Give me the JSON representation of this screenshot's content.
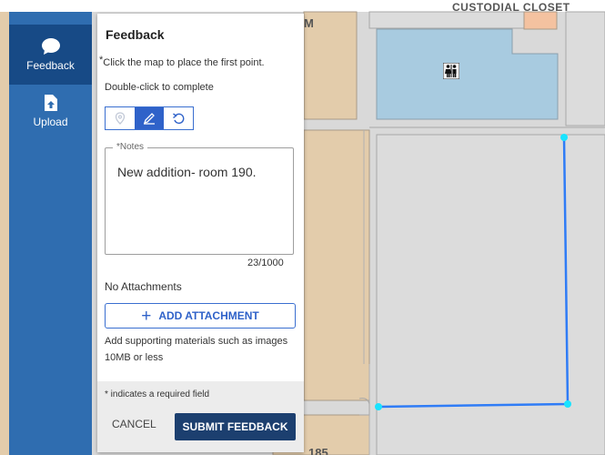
{
  "toolbar": {
    "items": [
      {
        "label": "Feedback",
        "icon": "chat-bubble-icon"
      },
      {
        "label": "Upload",
        "icon": "file-upload-icon"
      }
    ]
  },
  "map": {
    "labels": {
      "top_right": "CUSTODIAL CLOSET",
      "room_fragment": "M",
      "bottom_fragment": "185"
    },
    "restroom_icon": "restroom-icon",
    "colors": {
      "floor": "#d9d9d9",
      "room_tan": "#e3ccab",
      "room_blue": "#a8cbe0",
      "sketch_line": "#2f7cf6",
      "vertex": "#19e3ff"
    }
  },
  "panel": {
    "title": "Feedback",
    "instruction_line1": "Click the map to place the first point.",
    "required_mark": "*",
    "instruction_line2": "Double-click to complete",
    "tools": [
      "point-tool-icon",
      "draw-tool-icon",
      "undo-icon"
    ],
    "notes": {
      "label": "*Notes",
      "value": "New addition- room 190.",
      "counter": "23/1000"
    },
    "attachments": {
      "status": "No Attachments",
      "add_button": "ADD ATTACHMENT",
      "help": "Add supporting materials such as images 10MB or less"
    },
    "footer": {
      "required_note": "* indicates a required field",
      "cancel": "CANCEL",
      "submit": "SUBMIT FEEDBACK"
    }
  }
}
